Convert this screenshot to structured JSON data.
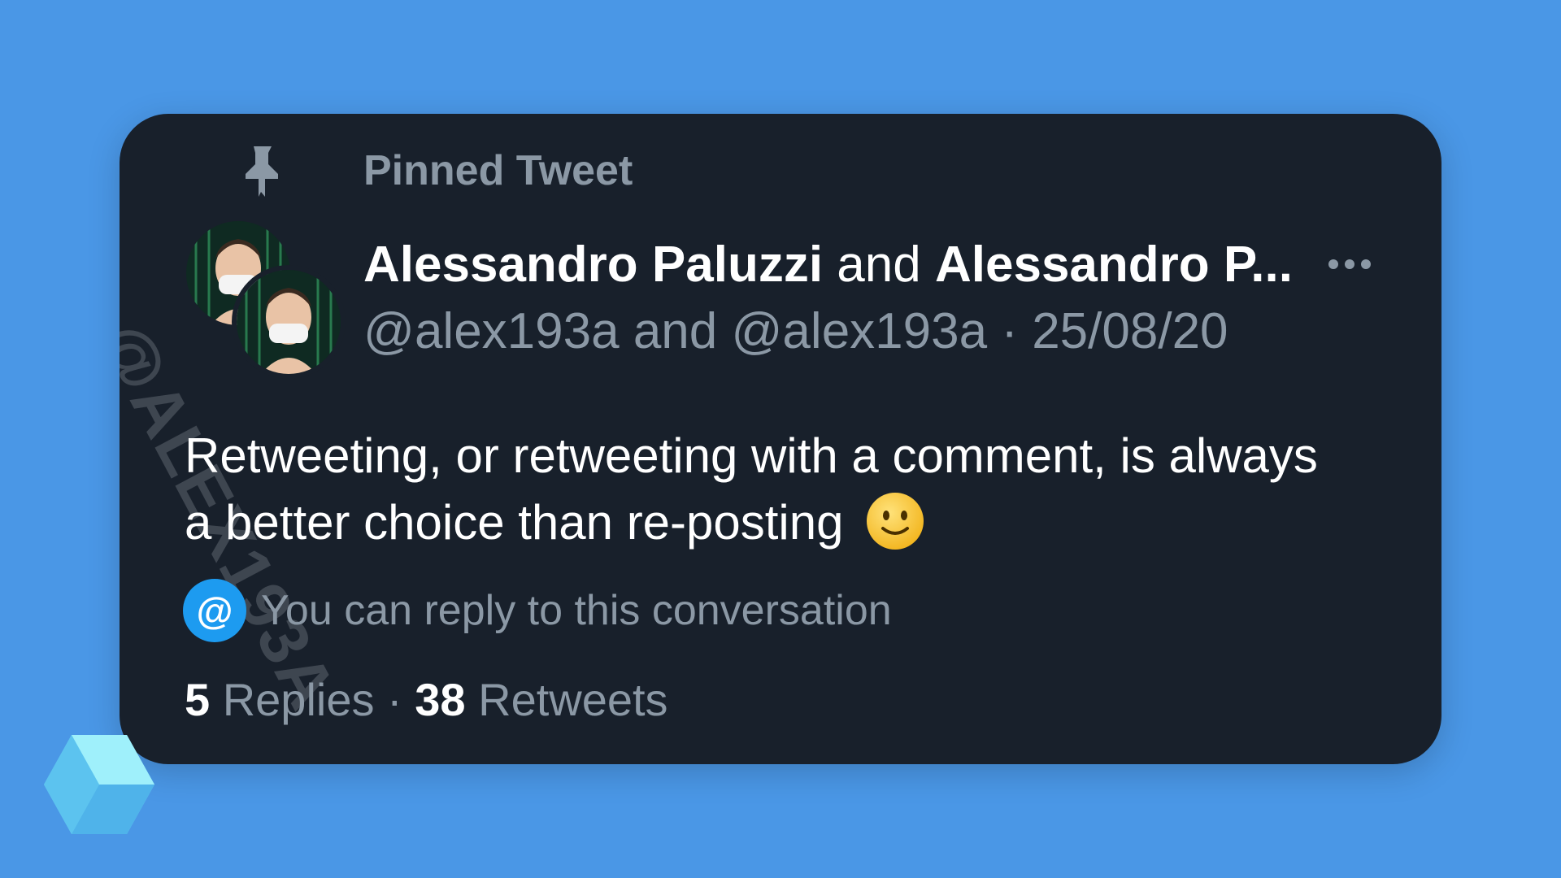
{
  "tweet": {
    "pinned_label": "Pinned Tweet",
    "author1_name": "Alessandro Paluzzi",
    "and_word": "and",
    "author2_name": "Alessandro P...",
    "handles_line": "@alex193a and @alex193a · 25/08/20",
    "text": "Retweeting, or retweeting with a comment, is always a better choice than re-posting",
    "emoji": "slightly-smiling-face",
    "reply_badge_symbol": "@",
    "reply_permission": "You can reply to this conversation",
    "replies_count": "5",
    "replies_label": "Replies",
    "separator": "·",
    "retweets_count": "38",
    "retweets_label": "Retweets"
  },
  "watermark": "@ALEX193A",
  "colors": {
    "background": "#4a97e6",
    "card": "#18202b",
    "secondary_text": "#8b98a5",
    "accent": "#1d9bf0"
  },
  "icons": {
    "pin": "pin-icon",
    "more": "more-horizontal-icon",
    "cube": "cube-logo-icon"
  }
}
